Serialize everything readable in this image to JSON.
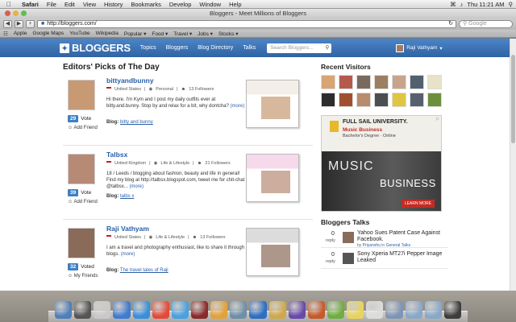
{
  "menubar": {
    "app": "Safari",
    "items": [
      "File",
      "Edit",
      "View",
      "History",
      "Bookmarks",
      "Develop",
      "Window",
      "Help"
    ],
    "clock": "Thu 11:21 AM"
  },
  "browser": {
    "window_title": "Bloggers - Meet Millions of Bloggers",
    "url": "http://bloggers.com/",
    "search_placeholder": "Google",
    "bookmarks": [
      "Apple",
      "Google Maps",
      "YouTube",
      "Wikipedia",
      "Popular ▾",
      "Food ▾",
      "Travel ▾",
      "Jobs ▾",
      "Stocks ▾"
    ]
  },
  "site": {
    "logo": "BLOGGERS",
    "nav": [
      "Topics",
      "Bloggers",
      "Blog Directory",
      "Talks"
    ],
    "search_placeholder": "Search Bloggers...",
    "user": "Raji Vathyam"
  },
  "main": {
    "title": "Editors' Picks of The Day",
    "picks": [
      {
        "name": "bittyandbunny",
        "country": "United States",
        "category": "Personal",
        "followers": "13 Followers",
        "desc": "Hi there. I'm Kym and I post my daily outfits ever at bitty.and.bunny. Stop by and relax for a bit, why dontcha?",
        "more": "(more)",
        "votes": "29",
        "vote_label": "Vote",
        "friend_label": "Add Friend",
        "blog_label": "Blog:",
        "blog": "bitty and bunny",
        "colors": {
          "photo": "#c79a74",
          "shot": "#f3eee7"
        }
      },
      {
        "name": "Talbsx",
        "country": "United Kingdom",
        "category": "Life & Lifestyle",
        "followers": "21 Followers",
        "desc": "18 / Leeds / blogging about fashion, beauty and life in general! Find my blog at http://talbsx.blogspot.com, tweet me for chit-chat @talbsx...",
        "more": "(more)",
        "votes": "39",
        "vote_label": "Vote",
        "friend_label": "Add Friend",
        "blog_label": "Blog:",
        "blog": "talbs x",
        "colors": {
          "photo": "#b68a75",
          "shot": "#f6d9ea"
        }
      },
      {
        "name": "Raji Vathyam",
        "country": "United States",
        "category": "Life & Lifestyle",
        "followers": "13 Followers",
        "desc": "I am a travel and photography enthusiast, like to share it through blogs.",
        "more": "(more)",
        "votes": "32",
        "vote_label": "Voted",
        "friend_label": "My Friends",
        "blog_label": "Blog:",
        "blog": "The travel tales of Raji",
        "colors": {
          "photo": "#8a6a58",
          "shot": "#dcdcdc"
        }
      }
    ]
  },
  "sidebar": {
    "visitors_title": "Recent Visitors",
    "visitor_colors": [
      "#d8a575",
      "#b55a4a",
      "#7a6a5e",
      "#9c7f63",
      "#c8a48c",
      "#53616f",
      "#e8e2c8",
      "#2d2d2d",
      "#a0502f",
      "#b98c6c",
      "#4c4f52",
      "#e0c640",
      "#58606e",
      "#6d8f3c"
    ],
    "ad": {
      "school": "FULL SAIL UNIVERSITY.",
      "program": "Music Business",
      "degree": "Bachelor's Degree · Online",
      "word1": "MUSIC",
      "word2": "BUSINESS",
      "cta": "LEARN MORE"
    },
    "talks_title": "Bloggers Talks",
    "talks": [
      {
        "count": "0",
        "reply": "reply",
        "title": "Yahoo Sues Patent Case Against Facebook.",
        "by": "by",
        "author": "Priyanshu",
        "in": "in",
        "board": "General Talks",
        "color": "#8a6a58"
      },
      {
        "count": "0",
        "reply": "reply",
        "title": "Sony Xperia MT27i Pepper Image Leaked",
        "by": "",
        "author": "",
        "in": "",
        "board": "",
        "color": "#555"
      }
    ]
  },
  "dock_colors": [
    "#4f7fb8",
    "#555555",
    "#c9c9c9",
    "#3f7bd1",
    "#3b8fd9",
    "#e24a3b",
    "#4aa0e0",
    "#8a2b2b",
    "#e2a23a",
    "#6f8fa8",
    "#2f6fc1",
    "#cfa84b",
    "#6a4aa8",
    "#c65a2b",
    "#6fae3f",
    "#e8d45c",
    "#dcdcdc",
    "#7f95b5",
    "#8aa8c8",
    "#8aa8c8",
    "#3d3d3d"
  ]
}
